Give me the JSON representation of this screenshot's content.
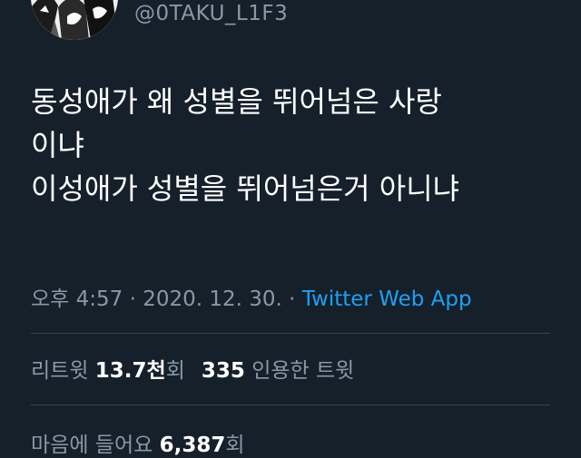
{
  "author": {
    "handle": "@0TAKU_L1F3",
    "avatar_icon": "manga-avatar"
  },
  "tweet": {
    "lines": [
      "동성애가 왜 성별을 뛰어넘은 사랑",
      "이냐",
      "이성애가 성별을 뛰어넘은거 아니냐"
    ]
  },
  "meta": {
    "time": "오후 4:57",
    "sep1": " · ",
    "date": "2020. 12. 30.",
    "sep2": " · ",
    "source": "Twitter Web App"
  },
  "stats": {
    "retweets": {
      "label": "리트윗",
      "value": "13.7천",
      "suffix": "회"
    },
    "quotes": {
      "value": "335",
      "label": "인용한 트윗"
    },
    "likes": {
      "label": "마음에 들어요",
      "value": "6,387",
      "suffix": "회"
    }
  },
  "colors": {
    "background": "#15202b",
    "text": "#ffffff",
    "secondary": "#8899a6",
    "link": "#1da1f2",
    "divider": "#38444d"
  }
}
